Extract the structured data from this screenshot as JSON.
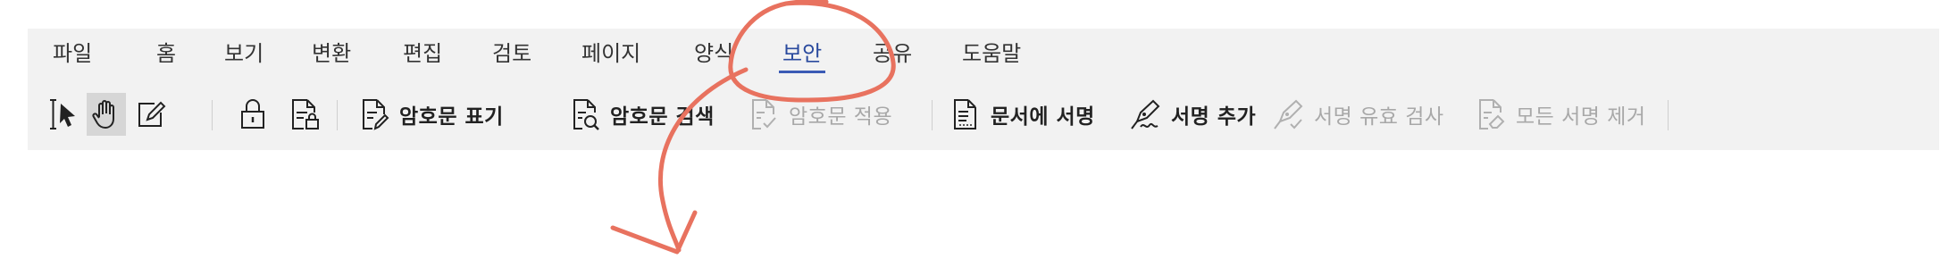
{
  "ribbon_tabs": [
    {
      "label": "파일"
    },
    {
      "label": "홈"
    },
    {
      "label": "보기"
    },
    {
      "label": "변환"
    },
    {
      "label": "편집"
    },
    {
      "label": "검토"
    },
    {
      "label": "페이지"
    },
    {
      "label": "양식"
    },
    {
      "label": "보안",
      "active": true
    },
    {
      "label": "공유"
    },
    {
      "label": "도움말"
    }
  ],
  "toolbar": {
    "select_text_tool": "text-cursor-select-icon",
    "hand_tool": "hand-icon",
    "edit_tool": "edit-box-icon",
    "password_protect": "lock-icon",
    "permissions": "document-lock-icon",
    "redaction": {
      "mark": {
        "label": "암호문 표기",
        "icon": "document-pen-icon"
      },
      "search": {
        "label": "암호문 검색",
        "icon": "document-search-icon"
      },
      "apply": {
        "label": "암호문 적용",
        "icon": "document-check-icon",
        "disabled": true
      }
    },
    "signature": {
      "sign_document": {
        "label": "문서에 서명",
        "icon": "document-sign-icon"
      },
      "add_signature": {
        "label": "서명 추가",
        "icon": "pen-signature-icon"
      },
      "validate_all": {
        "label": "서명 유효 검사",
        "icon": "pen-check-icon",
        "disabled": true
      },
      "remove_all": {
        "label": "모든 서명 제거",
        "icon": "document-eraser-icon",
        "disabled": true
      }
    }
  },
  "colors": {
    "active_tab": "#2a4a9e",
    "annotation": "#e8725f",
    "disabled_text": "#a8a8a8"
  }
}
